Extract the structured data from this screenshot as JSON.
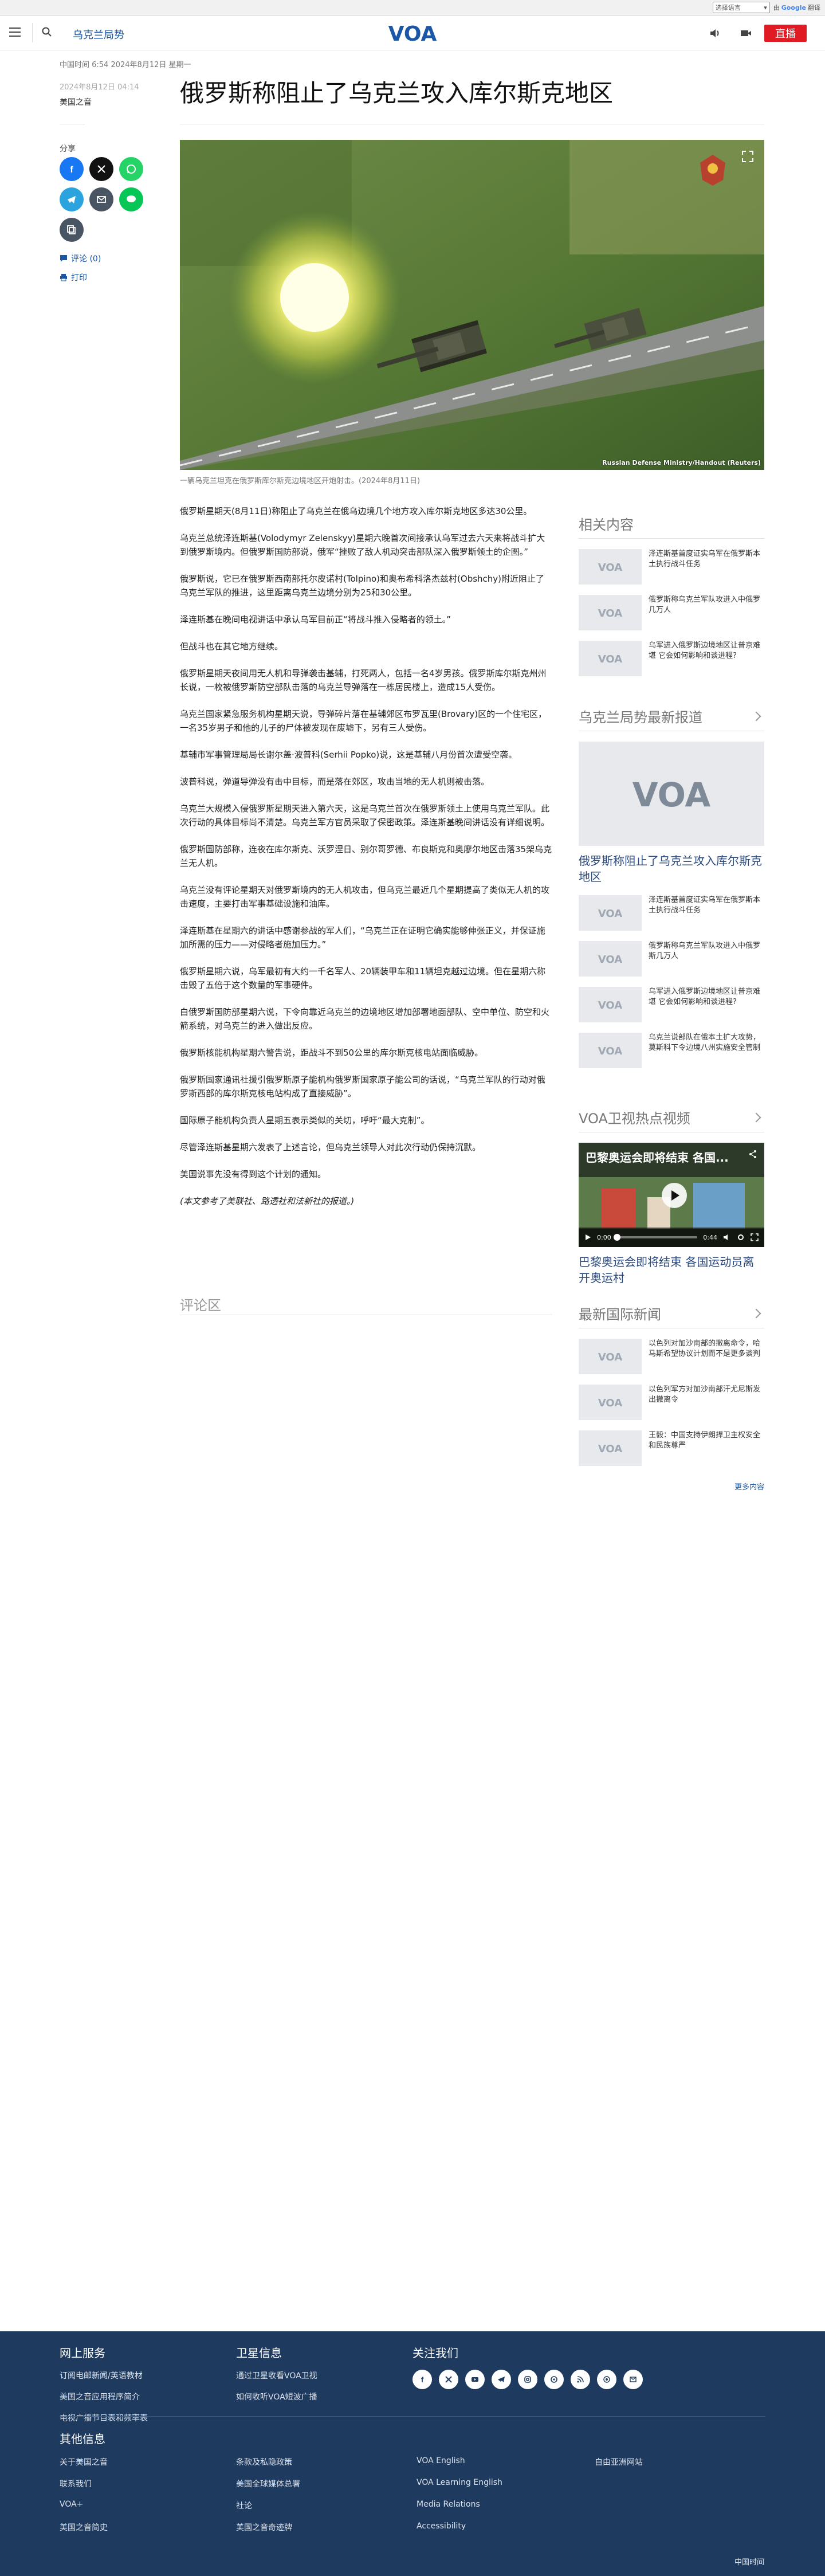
{
  "translate": {
    "select_label": "选择语言",
    "powered_by": "由",
    "google": "Google",
    "translate": "翻译"
  },
  "header": {
    "section": "乌克兰局势",
    "live_label": "直播",
    "logo_text": "VOA"
  },
  "article": {
    "meta": "中国时间 6:54 2024年8月12日 星期一",
    "pub_date": "2024年8月12日 04:14",
    "author": "美国之音",
    "headline": "俄罗斯称阻止了乌克兰攻入库尔斯克地区",
    "hero_credit": "Russian Defense Ministry/Handout (Reuters)",
    "caption": "一辆乌克兰坦克在俄罗斯库尔斯克边境地区开炮射击。(2024年8月11日)",
    "paragraphs": [
      "俄罗斯星期天(8月11日)称阻止了乌克兰在俄乌边境几个地方攻入库尔斯克地区多达30公里。",
      "乌克兰总统泽连斯基(Volodymyr Zelenskyy)星期六晚首次间接承认乌军过去六天来将战斗扩大到俄罗斯境内。但俄罗斯国防部说，俄军“挫败了敌人机动突击部队深入俄罗斯领土的企图。”",
      "俄罗斯说，它已在俄罗斯西南部托尔皮诺村(Tolpino)和奥布希科洛杰兹村(Obshchy)附近阻止了乌克兰军队的推进，这里距离乌克兰边境分别为25和30公里。",
      "泽连斯基在晚间电视讲话中承认乌军目前正“将战斗推入侵略者的领土。”",
      "但战斗也在其它地方继续。",
      "俄罗斯星期天夜间用无人机和导弹袭击基辅，打死两人，包括一名4岁男孩。俄罗斯库尔斯克州州长说，一枚被俄罗斯防空部队击落的乌克兰导弹落在一栋居民楼上，造成15人受伤。",
      "乌克兰国家紧急服务机构星期天说，导弹碎片落在基辅郊区布罗瓦里(Brovary)区的一个住宅区，一名35岁男子和他的儿子的尸体被发现在废墟下，另有三人受伤。",
      "基辅市军事管理局局长谢尔盖·波普科(Serhii Popko)说，这是基辅八月份首次遭受空袭。",
      "波普科说，弹道导弹没有击中目标，而是落在郊区，攻击当地的无人机则被击落。",
      "乌克兰大规模入侵俄罗斯星期天进入第六天，这是乌克兰首次在俄罗斯领土上使用乌克兰军队。此次行动的具体目标尚不清楚。乌克兰军方官员采取了保密政策。泽连斯基晚间讲话没有详细说明。",
      "俄罗斯国防部称，连夜在库尔斯克、沃罗涅日、别尔哥罗德、布良斯克和奥廖尔地区击落35架乌克兰无人机。",
      "乌克兰没有评论星期天对俄罗斯境内的无人机攻击，但乌克兰最近几个星期提高了类似无人机的攻击速度，主要打击军事基础设施和油库。",
      "泽连斯基在星期六的讲话中感谢参战的军人们，“乌克兰正在证明它确实能够伸张正义，并保证施加所需的压力——对侵略者施加压力。”",
      "俄罗斯星期六说，乌军最初有大约一千名军人、20辆装甲车和11辆坦克越过边境。但在星期六称击毁了五倍于这个数量的军事硬件。",
      "白俄罗斯国防部星期六说，下令向靠近乌克兰的边境地区增加部署地面部队、空中单位、防空和火箭系统，对乌克兰的进入做出反应。",
      "俄罗斯核能机构星期六警告说，距战斗不到50公里的库尔斯克核电站面临威胁。",
      "俄罗斯国家通讯社援引俄罗斯原子能机构俄罗斯国家原子能公司的话说，“乌克兰军队的行动对俄罗斯西部的库尔斯克核电站构成了直接威胁”。",
      "国际原子能机构负责人星期五表示类似的关切，呼吁“最大克制”。",
      "尽管泽连斯基星期六发表了上述言论，但乌克兰领导人对此次行动仍保持沉默。",
      "美国说事先没有得到这个计划的通知。"
    ],
    "note": "(本文参考了美联社、路透社和法新社的报道。)"
  },
  "share": {
    "label": "分享",
    "comments": "评论 (0)",
    "print": "打印"
  },
  "comments_title": "评论区",
  "sidebar": {
    "related": {
      "title": "相关内容",
      "items": [
        "泽连斯基首度证实乌军在俄罗斯本土执行战斗任务",
        "俄罗斯称乌克兰军队攻进入中俄罗几万人",
        "乌军进入俄罗斯边境地区让普京难堪 它会如何影响和谈进程?"
      ]
    },
    "ukraine": {
      "title": "乌克兰局势最新报道",
      "feature_title": "俄罗斯称阻止了乌克兰攻入库尔斯克地区",
      "items": [
        "泽连斯基首度证实乌军在俄罗斯本土执行战斗任务",
        "俄罗斯称乌克兰军队攻进入中俄罗斯几万人",
        "乌军进入俄罗斯边境地区让普京难堪 它会如何影响和谈进程?",
        "乌克兰说部队在俄本土扩大攻势，莫斯科下令边境八州实施安全管制"
      ]
    },
    "video": {
      "title": "VOA卫视热点视频",
      "overlay_title": "巴黎奥运会即将结束 各国...",
      "time_current": "0:00",
      "time_total": "0:44",
      "progress": 0,
      "caption": "巴黎奥运会即将结束 各国运动员离开奥运村"
    },
    "intl": {
      "title": "最新国际新闻",
      "items": [
        "以色列对加沙南部的撤离命令，哈马斯希望协议计划而不是更多谈判",
        "以色列军方对加沙南部汗尤尼斯发出撤离令",
        "王毅：中国支持伊朗捍卫主权安全和民族尊严"
      ],
      "more": "更多内容"
    }
  },
  "footer": {
    "col1": {
      "title": "网上服务",
      "links": [
        "订阅电邮新闻/英语教材",
        "美国之音应用程序简介",
        "电视广播节目表和频率表"
      ]
    },
    "col2": {
      "title": "卫星信息",
      "links": [
        "通过卫星收看VOA卫视",
        "如何收听VOA短波广播"
      ]
    },
    "col3": {
      "title": "关注我们"
    },
    "other_title": "其他信息",
    "grid": [
      [
        "关于美国之音",
        "条款及私隐政策",
        "VOA English",
        "自由亚洲网站"
      ],
      [
        "联系我们",
        "美国全球媒体总署",
        "VOA Learning English",
        ""
      ],
      [
        "VOA+",
        "社论",
        "Media Relations",
        ""
      ],
      [
        "美国之音简史",
        "美国之音奇迹牌",
        "Accessibility",
        ""
      ]
    ],
    "bottom": "中国时间"
  }
}
